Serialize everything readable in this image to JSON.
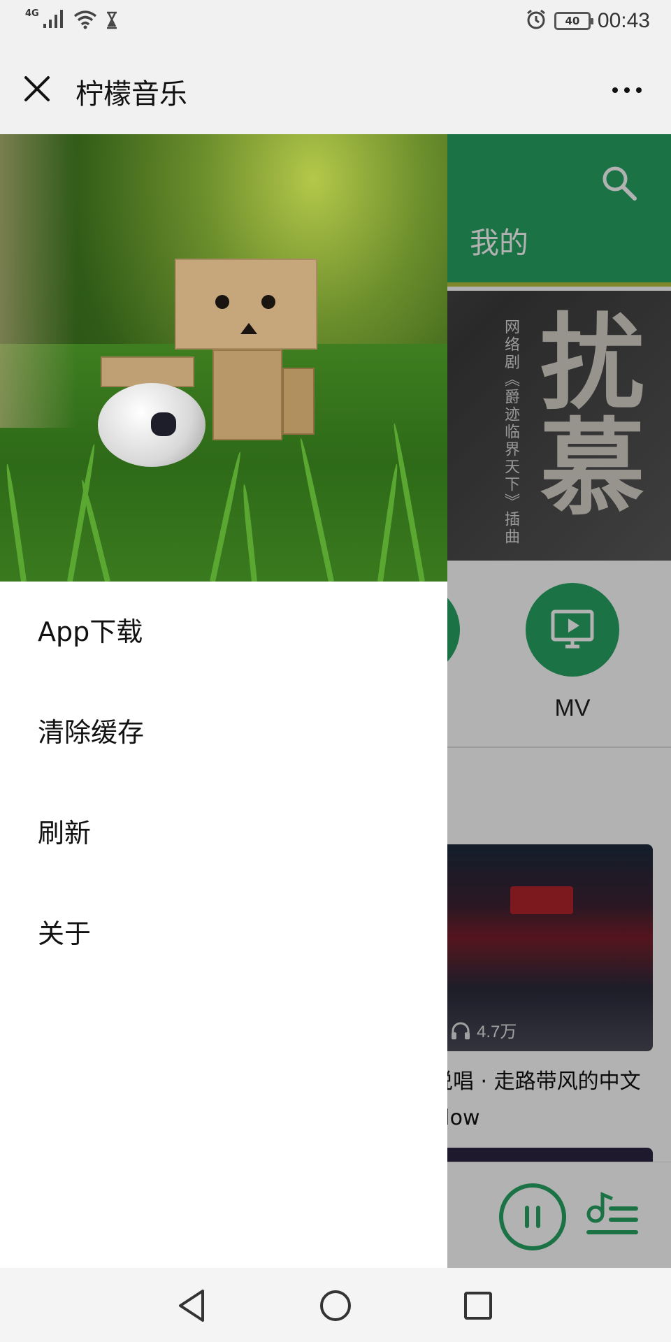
{
  "status_bar": {
    "network": "4G",
    "battery": "40",
    "time": "00:43",
    "icons": [
      "signal-icon",
      "wifi-icon",
      "hourglass-icon",
      "alarm-icon",
      "battery-icon"
    ]
  },
  "title_bar": {
    "close_icon": "close-icon",
    "title": "柠檬音乐",
    "more_icon": "more-icon"
  },
  "background": {
    "tab_mine": "我的",
    "banner": {
      "big_text": "扰慕",
      "subtitle": "网络剧《爵迹临界天下》插曲"
    },
    "nav": {
      "mv_label": "MV"
    },
    "card": {
      "plays": "4.7万",
      "title": "说唱 · 走路带风的中文Flow"
    },
    "accent_color": "#26a463"
  },
  "drawer": {
    "menu": [
      {
        "label": "App下载"
      },
      {
        "label": "清除缓存"
      },
      {
        "label": "刷新"
      },
      {
        "label": "关于"
      }
    ]
  },
  "nav_bar": {
    "icons": [
      "back-icon",
      "home-icon",
      "recents-icon"
    ]
  }
}
